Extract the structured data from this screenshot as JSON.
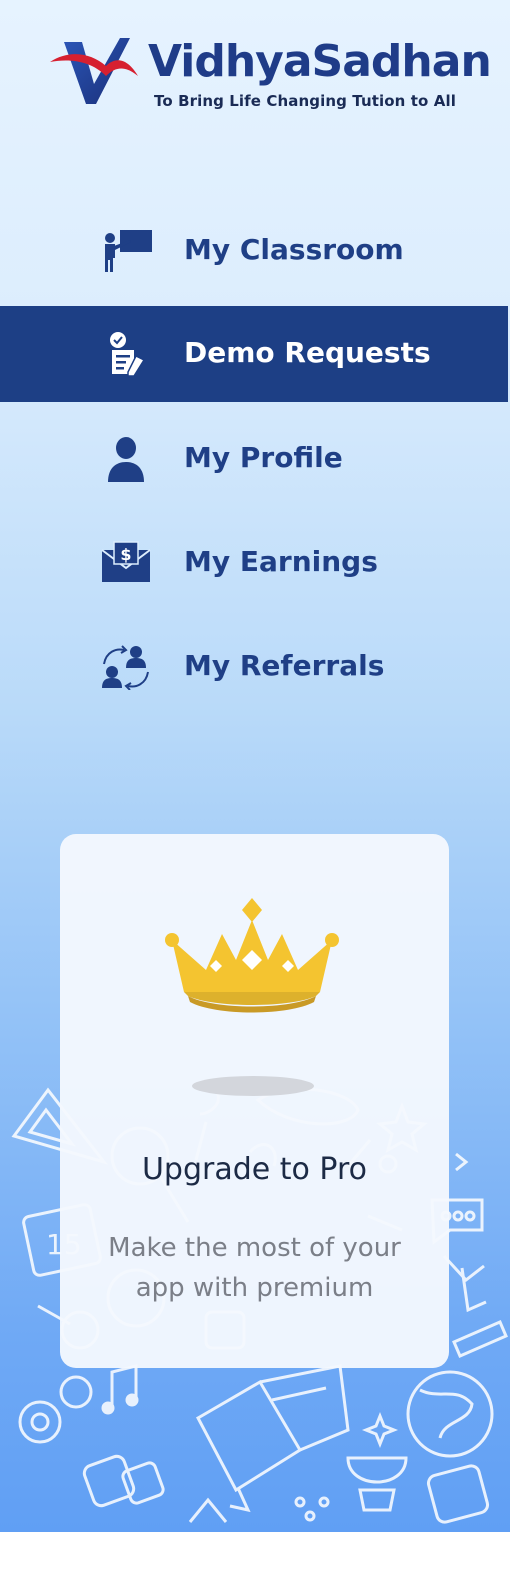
{
  "brand": {
    "name": "VidhyaSadhan",
    "tagline": "To Bring Life Changing Tution to All"
  },
  "menu": {
    "items": [
      {
        "label": "My Classroom",
        "icon": "teacher-board-icon",
        "active": false
      },
      {
        "label": "Demo Requests",
        "icon": "checklist-pen-icon",
        "active": true
      },
      {
        "label": "My Profile",
        "icon": "user-icon",
        "active": false
      },
      {
        "label": "My Earnings",
        "icon": "dollar-envelope-icon",
        "active": false
      },
      {
        "label": "My Referrals",
        "icon": "referral-users-icon",
        "active": false
      }
    ]
  },
  "upgrade": {
    "title": "Upgrade to Pro",
    "subtitle": "Make the most of your app with premium",
    "icon": "crown-icon"
  },
  "colors": {
    "primary": "#1d3f85",
    "crown": "#f4c430",
    "accent_red": "#d62030"
  }
}
